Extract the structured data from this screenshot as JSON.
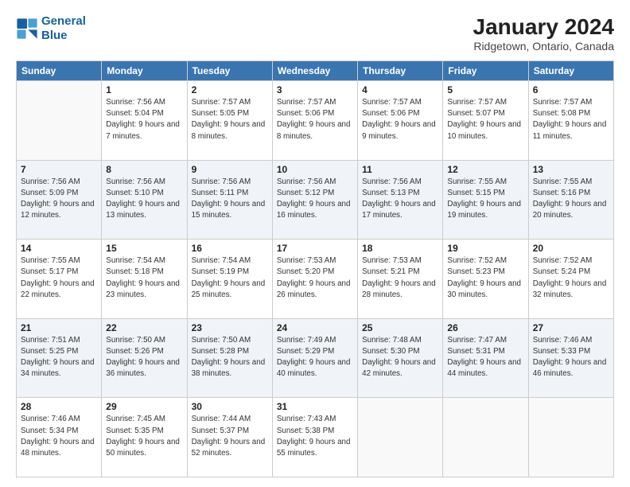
{
  "header": {
    "logo_line1": "General",
    "logo_line2": "Blue",
    "title": "January 2024",
    "subtitle": "Ridgetown, Ontario, Canada"
  },
  "days_of_week": [
    "Sunday",
    "Monday",
    "Tuesday",
    "Wednesday",
    "Thursday",
    "Friday",
    "Saturday"
  ],
  "weeks": [
    [
      {
        "day": "",
        "info": ""
      },
      {
        "day": "1",
        "info": "Sunrise: 7:56 AM\nSunset: 5:04 PM\nDaylight: 9 hours\nand 7 minutes."
      },
      {
        "day": "2",
        "info": "Sunrise: 7:57 AM\nSunset: 5:05 PM\nDaylight: 9 hours\nand 8 minutes."
      },
      {
        "day": "3",
        "info": "Sunrise: 7:57 AM\nSunset: 5:06 PM\nDaylight: 9 hours\nand 8 minutes."
      },
      {
        "day": "4",
        "info": "Sunrise: 7:57 AM\nSunset: 5:06 PM\nDaylight: 9 hours\nand 9 minutes."
      },
      {
        "day": "5",
        "info": "Sunrise: 7:57 AM\nSunset: 5:07 PM\nDaylight: 9 hours\nand 10 minutes."
      },
      {
        "day": "6",
        "info": "Sunrise: 7:57 AM\nSunset: 5:08 PM\nDaylight: 9 hours\nand 11 minutes."
      }
    ],
    [
      {
        "day": "7",
        "info": "Sunrise: 7:56 AM\nSunset: 5:09 PM\nDaylight: 9 hours\nand 12 minutes."
      },
      {
        "day": "8",
        "info": "Sunrise: 7:56 AM\nSunset: 5:10 PM\nDaylight: 9 hours\nand 13 minutes."
      },
      {
        "day": "9",
        "info": "Sunrise: 7:56 AM\nSunset: 5:11 PM\nDaylight: 9 hours\nand 15 minutes."
      },
      {
        "day": "10",
        "info": "Sunrise: 7:56 AM\nSunset: 5:12 PM\nDaylight: 9 hours\nand 16 minutes."
      },
      {
        "day": "11",
        "info": "Sunrise: 7:56 AM\nSunset: 5:13 PM\nDaylight: 9 hours\nand 17 minutes."
      },
      {
        "day": "12",
        "info": "Sunrise: 7:55 AM\nSunset: 5:15 PM\nDaylight: 9 hours\nand 19 minutes."
      },
      {
        "day": "13",
        "info": "Sunrise: 7:55 AM\nSunset: 5:16 PM\nDaylight: 9 hours\nand 20 minutes."
      }
    ],
    [
      {
        "day": "14",
        "info": "Sunrise: 7:55 AM\nSunset: 5:17 PM\nDaylight: 9 hours\nand 22 minutes."
      },
      {
        "day": "15",
        "info": "Sunrise: 7:54 AM\nSunset: 5:18 PM\nDaylight: 9 hours\nand 23 minutes."
      },
      {
        "day": "16",
        "info": "Sunrise: 7:54 AM\nSunset: 5:19 PM\nDaylight: 9 hours\nand 25 minutes."
      },
      {
        "day": "17",
        "info": "Sunrise: 7:53 AM\nSunset: 5:20 PM\nDaylight: 9 hours\nand 26 minutes."
      },
      {
        "day": "18",
        "info": "Sunrise: 7:53 AM\nSunset: 5:21 PM\nDaylight: 9 hours\nand 28 minutes."
      },
      {
        "day": "19",
        "info": "Sunrise: 7:52 AM\nSunset: 5:23 PM\nDaylight: 9 hours\nand 30 minutes."
      },
      {
        "day": "20",
        "info": "Sunrise: 7:52 AM\nSunset: 5:24 PM\nDaylight: 9 hours\nand 32 minutes."
      }
    ],
    [
      {
        "day": "21",
        "info": "Sunrise: 7:51 AM\nSunset: 5:25 PM\nDaylight: 9 hours\nand 34 minutes."
      },
      {
        "day": "22",
        "info": "Sunrise: 7:50 AM\nSunset: 5:26 PM\nDaylight: 9 hours\nand 36 minutes."
      },
      {
        "day": "23",
        "info": "Sunrise: 7:50 AM\nSunset: 5:28 PM\nDaylight: 9 hours\nand 38 minutes."
      },
      {
        "day": "24",
        "info": "Sunrise: 7:49 AM\nSunset: 5:29 PM\nDaylight: 9 hours\nand 40 minutes."
      },
      {
        "day": "25",
        "info": "Sunrise: 7:48 AM\nSunset: 5:30 PM\nDaylight: 9 hours\nand 42 minutes."
      },
      {
        "day": "26",
        "info": "Sunrise: 7:47 AM\nSunset: 5:31 PM\nDaylight: 9 hours\nand 44 minutes."
      },
      {
        "day": "27",
        "info": "Sunrise: 7:46 AM\nSunset: 5:33 PM\nDaylight: 9 hours\nand 46 minutes."
      }
    ],
    [
      {
        "day": "28",
        "info": "Sunrise: 7:46 AM\nSunset: 5:34 PM\nDaylight: 9 hours\nand 48 minutes."
      },
      {
        "day": "29",
        "info": "Sunrise: 7:45 AM\nSunset: 5:35 PM\nDaylight: 9 hours\nand 50 minutes."
      },
      {
        "day": "30",
        "info": "Sunrise: 7:44 AM\nSunset: 5:37 PM\nDaylight: 9 hours\nand 52 minutes."
      },
      {
        "day": "31",
        "info": "Sunrise: 7:43 AM\nSunset: 5:38 PM\nDaylight: 9 hours\nand 55 minutes."
      },
      {
        "day": "",
        "info": ""
      },
      {
        "day": "",
        "info": ""
      },
      {
        "day": "",
        "info": ""
      }
    ]
  ]
}
